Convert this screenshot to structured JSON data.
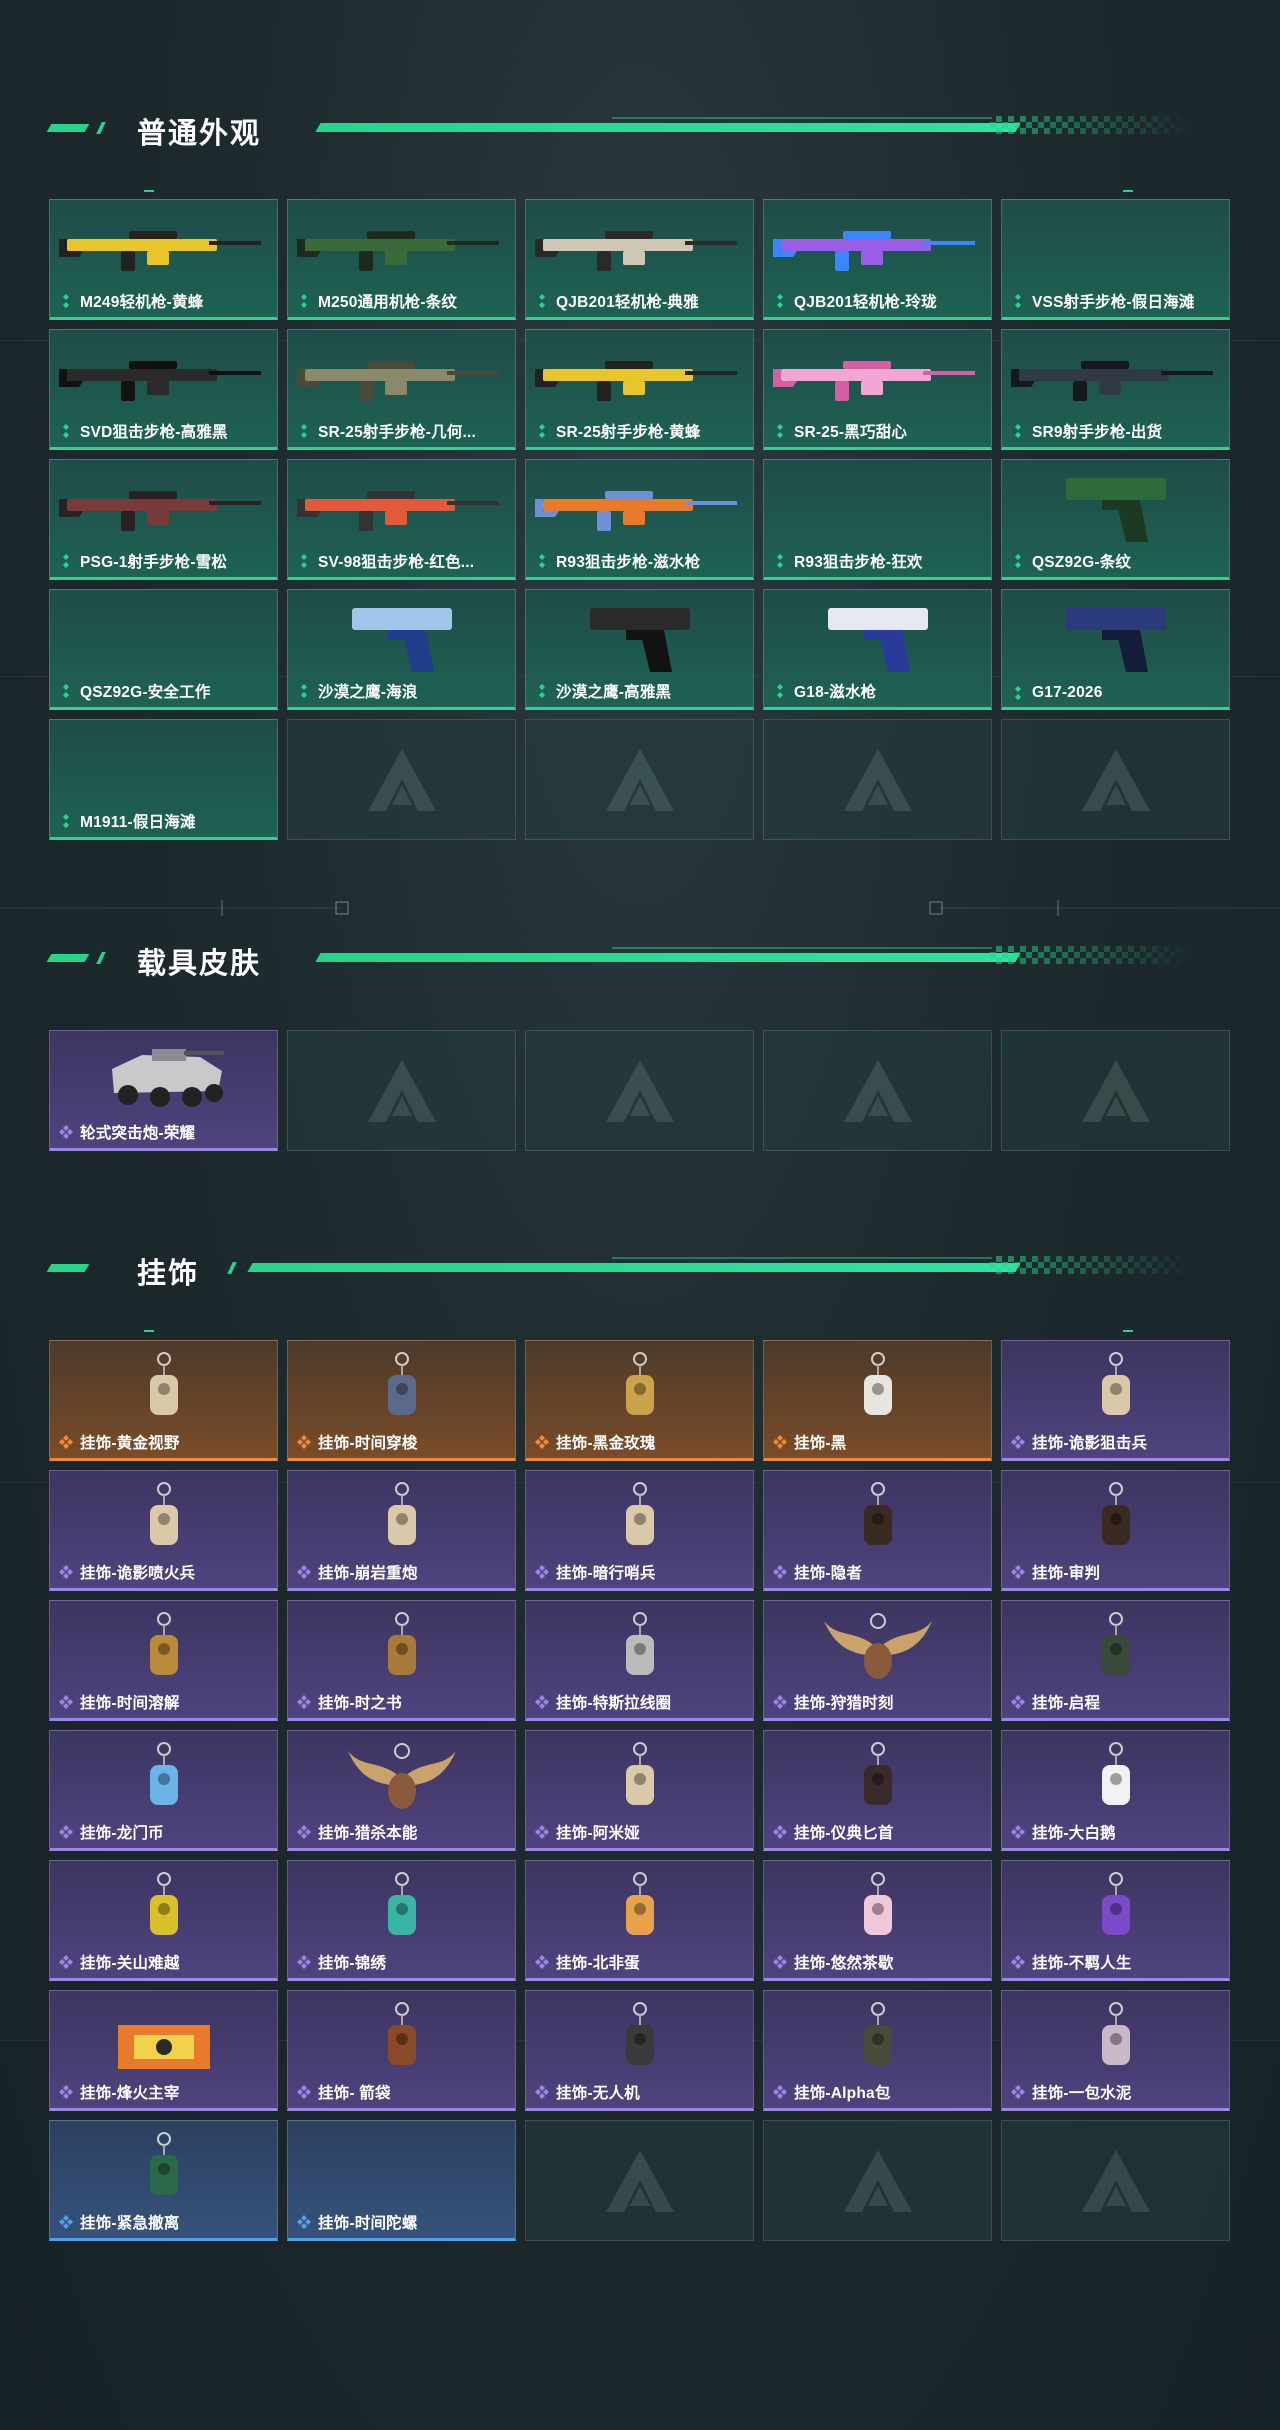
{
  "sections": {
    "weapons": {
      "title": "普通外观",
      "items": [
        {
          "label": "M249轻机枪-黄蜂",
          "rarity": "green",
          "icon": "lmg-yellow-icon"
        },
        {
          "label": "M250通用机枪-条纹",
          "rarity": "green",
          "icon": "lmg-green-icon"
        },
        {
          "label": "QJB201轻机枪-典雅",
          "rarity": "green",
          "icon": "lmg-tan-icon"
        },
        {
          "label": "QJB201轻机枪-玲珑",
          "rarity": "green",
          "icon": "lmg-purple-icon"
        },
        {
          "label": "VSS射手步枪-假日海滩",
          "rarity": "green",
          "icon": ""
        },
        {
          "label": "SVD狙击步枪-高雅黑",
          "rarity": "green",
          "icon": "sniper-black-icon"
        },
        {
          "label": "SR-25射手步枪-几何...",
          "rarity": "green",
          "icon": "rifle-camo-icon"
        },
        {
          "label": "SR-25射手步枪-黄蜂",
          "rarity": "green",
          "icon": "rifle-yellow-icon"
        },
        {
          "label": "SR-25-黑巧甜心",
          "rarity": "green",
          "icon": "rifle-pink-icon"
        },
        {
          "label": "SR9射手步枪-出货",
          "rarity": "green",
          "icon": "rifle-dark-icon"
        },
        {
          "label": "PSG-1射手步枪-雪松",
          "rarity": "green",
          "icon": "sniper-red-icon"
        },
        {
          "label": "SV-98狙击步枪-红色...",
          "rarity": "green",
          "icon": "sniper-orange-icon"
        },
        {
          "label": "R93狙击步枪-滋水枪",
          "rarity": "green",
          "icon": "sniper-water-icon"
        },
        {
          "label": "R93狙击步枪-狂欢",
          "rarity": "green",
          "icon": ""
        },
        {
          "label": "QSZ92G-条纹",
          "rarity": "green",
          "icon": "pistol-green-icon"
        },
        {
          "label": "QSZ92G-安全工作",
          "rarity": "green",
          "icon": ""
        },
        {
          "label": "沙漠之鹰-海浪",
          "rarity": "green",
          "icon": "pistol-wave-icon"
        },
        {
          "label": "沙漠之鹰-高雅黑",
          "rarity": "green",
          "icon": "pistol-black-icon"
        },
        {
          "label": "G18-滋水枪",
          "rarity": "green",
          "icon": "pistol-water-icon"
        },
        {
          "label": "G17-2026",
          "rarity": "green",
          "icon": "pistol-navy-icon"
        },
        {
          "label": "M1911-假日海滩",
          "rarity": "green",
          "icon": ""
        }
      ],
      "empty_count": 4
    },
    "vehicles": {
      "title": "载具皮肤",
      "items": [
        {
          "label": "轮式突击炮-荣耀",
          "rarity": "purple",
          "icon": "armored-vehicle-icon"
        }
      ],
      "empty_count": 4
    },
    "charms": {
      "title": "挂饰",
      "items": [
        {
          "label": "挂饰-黄金视野",
          "rarity": "orange",
          "icon": "charm-figure-icon"
        },
        {
          "label": "挂饰-时间穿梭",
          "rarity": "orange",
          "icon": "charm-compass-icon"
        },
        {
          "label": "挂饰-黑金玫瑰",
          "rarity": "orange",
          "icon": "charm-rose-icon"
        },
        {
          "label": "挂饰-黑",
          "rarity": "orange",
          "icon": "charm-tag-icon"
        },
        {
          "label": "挂饰-诡影狙击兵",
          "rarity": "purple",
          "icon": "charm-figure-icon"
        },
        {
          "label": "挂饰-诡影喷火兵",
          "rarity": "purple",
          "icon": "charm-figure-icon"
        },
        {
          "label": "挂饰-崩岩重炮",
          "rarity": "purple",
          "icon": "charm-figure-icon"
        },
        {
          "label": "挂饰-暗行哨兵",
          "rarity": "purple",
          "icon": "charm-figure-icon"
        },
        {
          "label": "挂饰-隐者",
          "rarity": "purple",
          "icon": "charm-card-icon"
        },
        {
          "label": "挂饰-审判",
          "rarity": "purple",
          "icon": "charm-card-icon"
        },
        {
          "label": "挂饰-时间溶解",
          "rarity": "purple",
          "icon": "charm-key-icon"
        },
        {
          "label": "挂饰-时之书",
          "rarity": "purple",
          "icon": "charm-book-icon"
        },
        {
          "label": "挂饰-特斯拉线圈",
          "rarity": "purple",
          "icon": "charm-coil-icon"
        },
        {
          "label": "挂饰-狩猎时刻",
          "rarity": "purple",
          "icon": "charm-antler-icon"
        },
        {
          "label": "挂饰-启程",
          "rarity": "purple",
          "icon": "charm-coin-icon"
        },
        {
          "label": "挂饰-龙门币",
          "rarity": "purple",
          "icon": "charm-crystal-icon"
        },
        {
          "label": "挂饰-猎杀本能",
          "rarity": "purple",
          "icon": "charm-antler-icon"
        },
        {
          "label": "挂饰-阿米娅",
          "rarity": "purple",
          "icon": "charm-figure-icon"
        },
        {
          "label": "挂饰-仪典匕首",
          "rarity": "purple",
          "icon": "charm-dagger-icon"
        },
        {
          "label": "挂饰-大白鹅",
          "rarity": "purple",
          "icon": "charm-goose-icon"
        },
        {
          "label": "挂饰-关山难越",
          "rarity": "purple",
          "icon": "charm-can-icon"
        },
        {
          "label": "挂饰-锦绣",
          "rarity": "purple",
          "icon": "charm-butterfly-icon"
        },
        {
          "label": "挂饰-北非蛋",
          "rarity": "purple",
          "icon": "charm-egg-icon"
        },
        {
          "label": "挂饰-悠然茶歇",
          "rarity": "purple",
          "icon": "charm-cupcake-icon"
        },
        {
          "label": "挂饰-不羁人生",
          "rarity": "purple",
          "icon": "charm-shoe-icon"
        },
        {
          "label": "挂饰-烽火主宰",
          "rarity": "purple",
          "icon": "charm-container-icon"
        },
        {
          "label": "挂饰- 箭袋",
          "rarity": "purple",
          "icon": "charm-quiver-icon"
        },
        {
          "label": "挂饰-无人机",
          "rarity": "purple",
          "icon": "charm-drone-icon"
        },
        {
          "label": "挂饰-Alpha包",
          "rarity": "purple",
          "icon": "charm-bag-icon"
        },
        {
          "label": "挂饰-一包水泥",
          "rarity": "purple",
          "icon": "charm-sack-icon"
        },
        {
          "label": "挂饰-紧急撤离",
          "rarity": "blue",
          "icon": "charm-cube-icon"
        },
        {
          "label": "挂饰-时间陀螺",
          "rarity": "blue",
          "icon": ""
        }
      ],
      "empty_count": 3
    }
  },
  "colors": {
    "accent": "#27d48a",
    "green_rarity": "#2cd391",
    "purple_rarity": "#9b86e8",
    "orange_rarity": "#f08a34",
    "blue_rarity": "#4fa3e6"
  }
}
